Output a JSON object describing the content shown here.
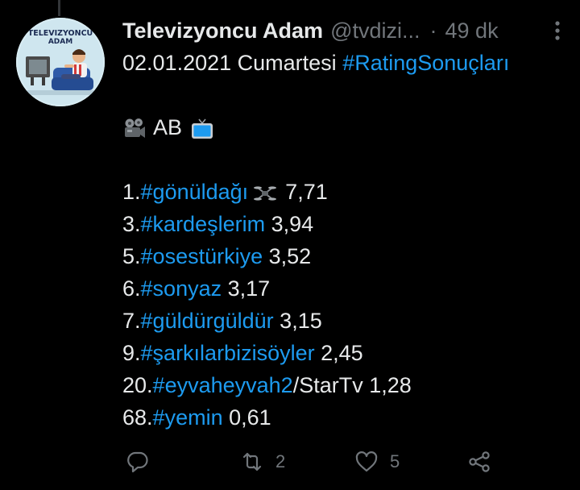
{
  "tweet": {
    "display_name": "Televizyoncu Adam",
    "handle": "@tvdizi...",
    "separator": "·",
    "time": "49 dk",
    "more_icon": "more-vertical-icon",
    "avatar_text_line1": "TELEVIZYONCU",
    "avatar_text_line2": "ADAM",
    "date_text": "02.01.2021 Cumartesi",
    "date_hashtag": "#RatingSonuçları",
    "category_text": "AB",
    "category_icons": [
      "movie-camera-icon",
      "television-icon"
    ],
    "rankings": [
      {
        "rank": "1.",
        "hashtag": "#gönüldağı",
        "suffix": "",
        "value": "7,71",
        "icon": "drone-icon"
      },
      {
        "rank": "3.",
        "hashtag": "#kardeşlerim",
        "suffix": "",
        "value": "3,94"
      },
      {
        "rank": "5.",
        "hashtag": "#osestürkiye",
        "suffix": "",
        "value": "3,52"
      },
      {
        "rank": "6.",
        "hashtag": "#sonyaz",
        "suffix": "",
        "value": "3,17"
      },
      {
        "rank": "7.",
        "hashtag": "#güldürgüldür",
        "suffix": "",
        "value": "3,15"
      },
      {
        "rank": "9.",
        "hashtag": "#şarkılarbizisöyler",
        "suffix": "",
        "value": "2,45"
      },
      {
        "rank": "20.",
        "hashtag": "#eyvaheyvah2",
        "suffix": "/StarTv",
        "value": "1,28"
      },
      {
        "rank": "68.",
        "hashtag": "#yemin",
        "suffix": "",
        "value": "0,61"
      }
    ]
  },
  "actions": {
    "reply_icon": "reply-icon",
    "retweet_icon": "retweet-icon",
    "retweet_count": "2",
    "like_icon": "heart-icon",
    "like_count": "5",
    "share_icon": "share-icon"
  },
  "colors": {
    "background": "#000000",
    "text": "#e7e9ea",
    "secondary": "#71767b",
    "accent": "#1d9bf0"
  }
}
